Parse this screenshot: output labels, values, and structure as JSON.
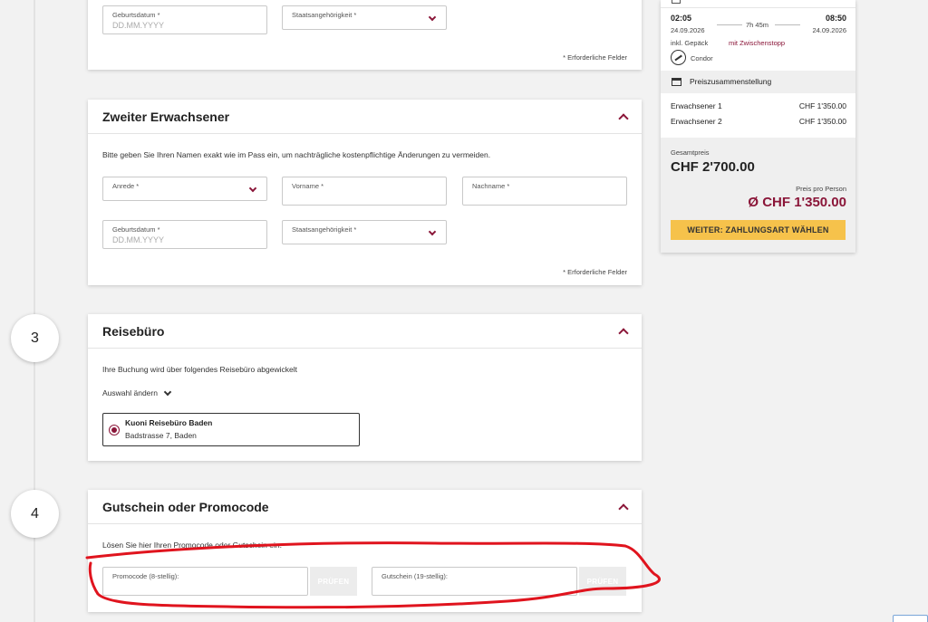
{
  "steps": {
    "step3": "3",
    "step4": "4"
  },
  "first_adult": {
    "birthdate_label": "Geburtsdatum *",
    "birthdate_placeholder": "DD.MM.YYYY",
    "nationality_label": "Staatsangehörigkeit *",
    "required_note": "* Erforderliche Felder"
  },
  "second_adult": {
    "title": "Zweiter Erwachsener",
    "intro": "Bitte geben Sie Ihren Namen exakt wie im Pass ein, um nachträgliche kostenpflichtige Änderungen zu vermeiden.",
    "salutation_label": "Anrede *",
    "firstname_label": "Vorname *",
    "lastname_label": "Nachname *",
    "birthdate_label": "Geburtsdatum *",
    "birthdate_placeholder": "DD.MM.YYYY",
    "nationality_label": "Staatsangehörigkeit *",
    "required_note": "* Erforderliche Felder"
  },
  "travel_agency": {
    "title": "Reisebüro",
    "intro": "Ihre Buchung wird über folgendes Reisebüro abgewickelt",
    "change_label": "Auswahl ändern",
    "selected_name": "Kuoni Reisebüro Baden",
    "selected_address": "Badstrasse 7, Baden"
  },
  "voucher": {
    "title": "Gutschein oder Promocode",
    "intro": "Lösen Sie hier Ihren Promocode oder Gutschein ein:",
    "promo_label": "Promocode (8-stellig):",
    "voucher_label": "Gutschein (19-stellig):",
    "check_label": "PRÜFEN"
  },
  "summary": {
    "depart_time": "02:05",
    "duration": "7h 45m",
    "arrive_time": "08:50",
    "depart_date": "24.09.2026",
    "arrive_date": "24.09.2026",
    "baggage": "inkl. Gepäck",
    "stopover": "mit Zwischenstopp",
    "airline": "Condor",
    "price_breakdown_title": "Preiszusammenstellung",
    "pax1_label": "Erwachsener 1",
    "pax1_price": "CHF 1'350.00",
    "pax2_label": "Erwachsener 2",
    "pax2_price": "CHF 1'350.00",
    "total_label": "Gesamtpreis",
    "total_price": "CHF 2'700.00",
    "per_person_label": "Preis pro Person",
    "per_person_price": "Ø CHF 1'350.00",
    "cta_label": "WEITER: ZAHLUNGSART WÄHLEN"
  },
  "colors": {
    "accent": "#8a1538",
    "cta": "#f6c24b",
    "annotation": "#e0141e"
  }
}
